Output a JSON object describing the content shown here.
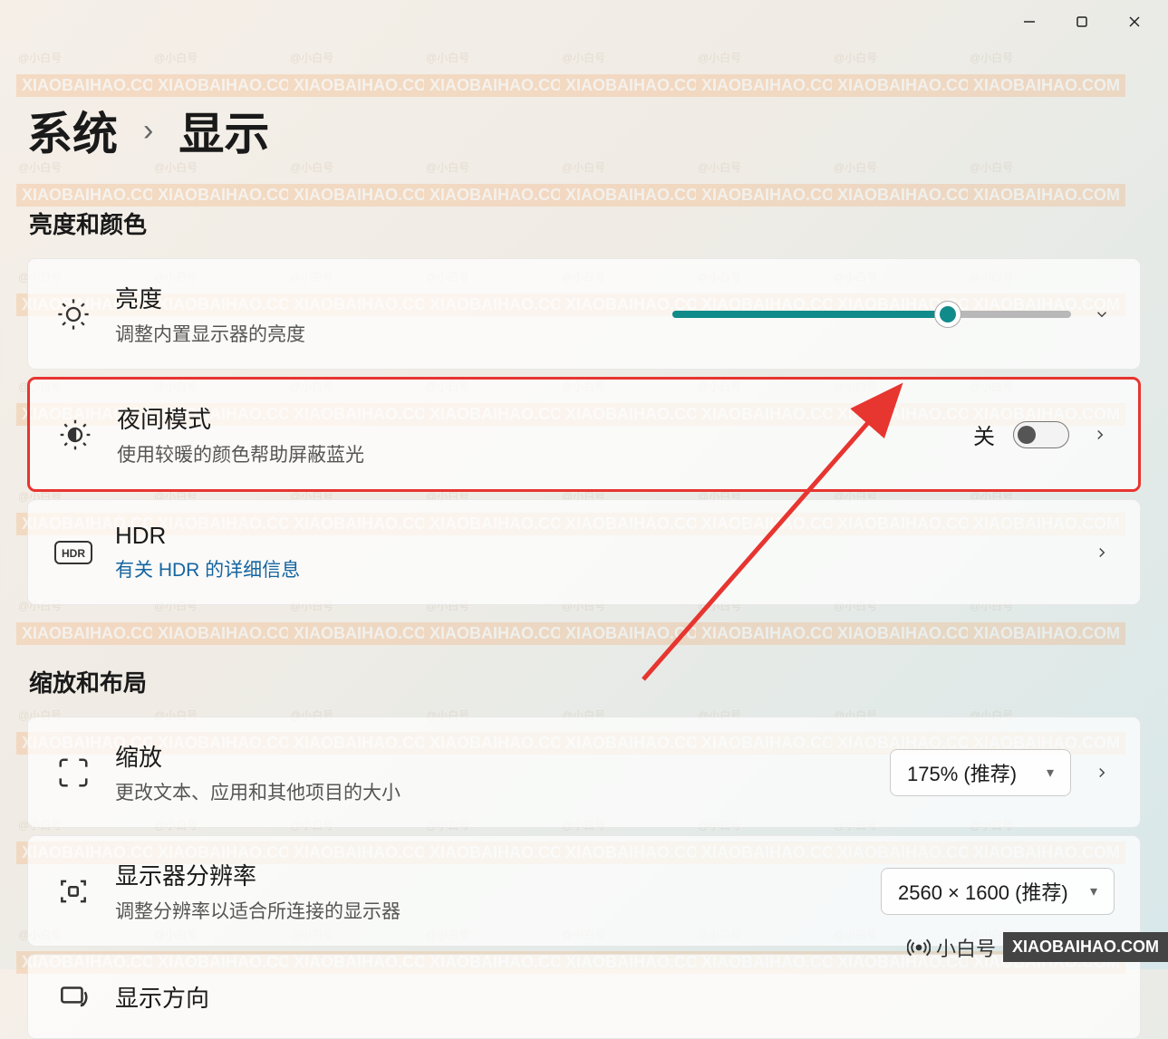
{
  "breadcrumb": {
    "parent": "系统",
    "current": "显示"
  },
  "sections": {
    "brightness_color_title": "亮度和颜色",
    "scale_layout_title": "缩放和布局"
  },
  "brightness": {
    "title": "亮度",
    "subtitle": "调整内置显示器的亮度",
    "value_percent": 69
  },
  "night_light": {
    "title": "夜间模式",
    "subtitle": "使用较暖的颜色帮助屏蔽蓝光",
    "state_label": "关",
    "enabled": false
  },
  "hdr": {
    "title": "HDR",
    "link_text": "有关 HDR 的详细信息"
  },
  "scale": {
    "title": "缩放",
    "subtitle": "更改文本、应用和其他项目的大小",
    "selected": "175% (推荐)"
  },
  "resolution": {
    "title": "显示器分辨率",
    "subtitle": "调整分辨率以适合所连接的显示器",
    "selected": "2560 × 1600 (推荐)"
  },
  "orientation": {
    "title": "显示方向"
  },
  "watermark": {
    "handle": "@小白号",
    "domain": "XIAOBAIHAO.COM",
    "badge_text": "小白号"
  }
}
